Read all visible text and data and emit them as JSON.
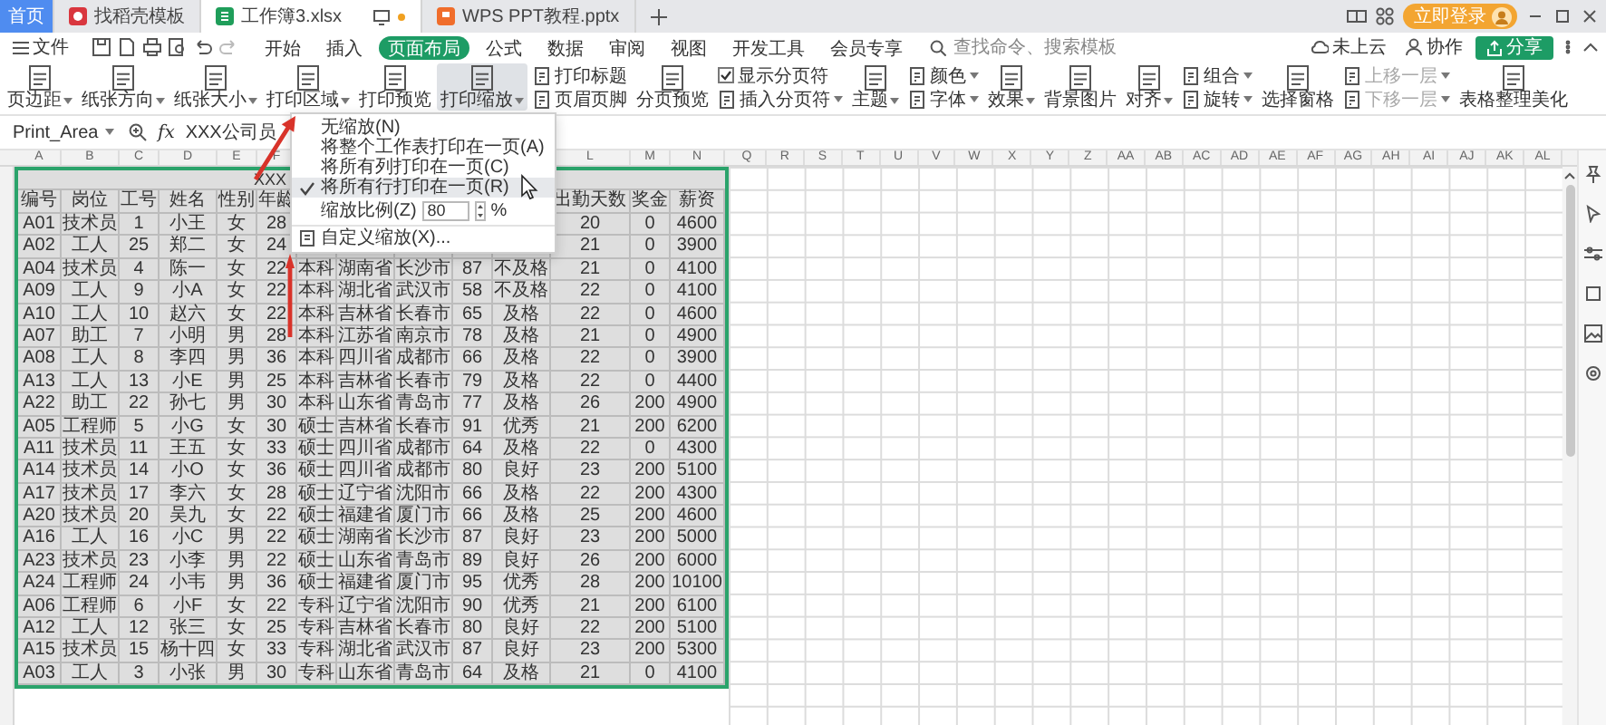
{
  "tabs": [
    {
      "label": "首页",
      "kind": "home",
      "selected": false,
      "modified": false
    },
    {
      "label": "找稻壳模板",
      "kind": "template",
      "selected": false,
      "modified": false
    },
    {
      "label": "工作簿3.xlsx",
      "kind": "sheet",
      "selected": true,
      "modified": true
    },
    {
      "label": "WPS PPT教程.pptx",
      "kind": "slides",
      "selected": false,
      "modified": false
    }
  ],
  "account": {
    "label": "立即登录"
  },
  "menu": {
    "file": "文件",
    "tabs": [
      {
        "label": "开始",
        "selected": false
      },
      {
        "label": "插入",
        "selected": false
      },
      {
        "label": "页面布局",
        "selected": true
      },
      {
        "label": "公式",
        "selected": false
      },
      {
        "label": "数据",
        "selected": false
      },
      {
        "label": "审阅",
        "selected": false
      },
      {
        "label": "视图",
        "selected": false
      },
      {
        "label": "开发工具",
        "selected": false
      },
      {
        "label": "会员专享",
        "selected": false
      }
    ],
    "search": {
      "placeholder": "查找命令、搜索模板"
    },
    "cloud": "未上云",
    "collab": "协作",
    "share": "分享"
  },
  "ribbon": [
    {
      "kind": "large",
      "label": "页边距",
      "caret": true,
      "selected": false
    },
    {
      "kind": "large",
      "label": "纸张方向",
      "caret": true,
      "selected": false
    },
    {
      "kind": "large",
      "label": "纸张大小",
      "caret": true,
      "selected": false
    },
    {
      "kind": "large",
      "label": "打印区域",
      "caret": true,
      "selected": false
    },
    {
      "kind": "large",
      "label": "打印预览",
      "caret": false,
      "selected": false
    },
    {
      "kind": "large",
      "label": "打印缩放",
      "caret": true,
      "selected": true
    },
    {
      "kind": "stack",
      "items": [
        {
          "kind": "button",
          "label": "打印标题",
          "caret": false,
          "disabled": false
        },
        {
          "kind": "button",
          "label": "页眉页脚",
          "caret": false,
          "disabled": false
        }
      ]
    },
    {
      "kind": "large",
      "label": "分页预览",
      "caret": false,
      "selected": false
    },
    {
      "kind": "stack",
      "items": [
        {
          "kind": "checkbox",
          "label": "显示分页符",
          "checked": true,
          "caret": false,
          "disabled": false
        },
        {
          "kind": "button",
          "label": "插入分页符",
          "caret": true,
          "disabled": false
        }
      ]
    },
    {
      "kind": "large",
      "label": "主题",
      "caret": true,
      "selected": false
    },
    {
      "kind": "stack",
      "items": [
        {
          "kind": "button",
          "label": "颜色",
          "caret": true,
          "disabled": false
        },
        {
          "kind": "button",
          "label": "字体",
          "caret": true,
          "disabled": false
        }
      ]
    },
    {
      "kind": "large",
      "label": "效果",
      "caret": true,
      "selected": false
    },
    {
      "kind": "large",
      "label": "背景图片",
      "caret": false,
      "selected": false
    },
    {
      "kind": "large",
      "label": "对齐",
      "caret": true,
      "selected": false
    },
    {
      "kind": "stack",
      "items": [
        {
          "kind": "button",
          "label": "组合",
          "caret": true,
          "disabled": false
        },
        {
          "kind": "button",
          "label": "旋转",
          "caret": true,
          "disabled": false
        }
      ]
    },
    {
      "kind": "large",
      "label": "选择窗格",
      "caret": false,
      "selected": false
    },
    {
      "kind": "stack",
      "items": [
        {
          "kind": "button",
          "label": "上移一层",
          "caret": true,
          "disabled": true
        },
        {
          "kind": "button",
          "label": "下移一层",
          "caret": true,
          "disabled": true
        }
      ]
    },
    {
      "kind": "large",
      "label": "表格整理美化",
      "caret": false,
      "selected": false
    }
  ],
  "formula_bar": {
    "name_box": "Print_Area",
    "function": "fx",
    "value": "XXX公司员"
  },
  "sheet": {
    "columns_left": {
      "before_menu": [
        "A",
        "B",
        "C",
        "D",
        "E",
        "F"
      ],
      "after_menu": [
        "L",
        "M",
        "N"
      ]
    },
    "columns_right": [
      "Q",
      "R",
      "S",
      "T",
      "U",
      "V",
      "W",
      "X",
      "Y",
      "Z",
      "AA",
      "AB",
      "AC",
      "AD",
      "AE",
      "AF",
      "AG",
      "AH",
      "AI",
      "AJ",
      "AK",
      "AL"
    ],
    "title": "XXX",
    "header": {
      "before_menu": [
        "编号",
        "岗位",
        "工号",
        "姓名",
        "性别",
        "年龄"
      ],
      "after_menu": [
        "出勤天数",
        "奖金",
        "薪资"
      ]
    },
    "rows": [
      [
        "A01",
        "技术员",
        "1",
        "小王",
        "女",
        "28",
        null,
        null,
        null,
        null,
        null,
        "20",
        "0",
        "4600"
      ],
      [
        "A02",
        "工人",
        "25",
        "郑二",
        "女",
        "24",
        null,
        null,
        null,
        null,
        null,
        "21",
        "0",
        "3900"
      ],
      [
        "A04",
        "技术员",
        "4",
        "陈一",
        "女",
        "22",
        "本科",
        "湖南省",
        "长沙市",
        "87",
        "不及格",
        "21",
        "0",
        "4100"
      ],
      [
        "A09",
        "工人",
        "9",
        "小A",
        "女",
        "22",
        "本科",
        "湖北省",
        "武汉市",
        "58",
        "不及格",
        "22",
        "0",
        "4100"
      ],
      [
        "A10",
        "工人",
        "10",
        "赵六",
        "女",
        "22",
        "本科",
        "吉林省",
        "长春市",
        "65",
        "及格",
        "22",
        "0",
        "4600"
      ],
      [
        "A07",
        "助工",
        "7",
        "小明",
        "男",
        "28",
        "本科",
        "江苏省",
        "南京市",
        "78",
        "及格",
        "21",
        "0",
        "4900"
      ],
      [
        "A08",
        "工人",
        "8",
        "李四",
        "男",
        "36",
        "本科",
        "四川省",
        "成都市",
        "66",
        "及格",
        "22",
        "0",
        "3900"
      ],
      [
        "A13",
        "工人",
        "13",
        "小E",
        "男",
        "25",
        "本科",
        "吉林省",
        "长春市",
        "79",
        "及格",
        "22",
        "0",
        "4400"
      ],
      [
        "A22",
        "助工",
        "22",
        "孙七",
        "男",
        "30",
        "本科",
        "山东省",
        "青岛市",
        "77",
        "及格",
        "26",
        "200",
        "4900"
      ],
      [
        "A05",
        "工程师",
        "5",
        "小G",
        "女",
        "30",
        "硕士",
        "吉林省",
        "长春市",
        "91",
        "优秀",
        "21",
        "200",
        "6200"
      ],
      [
        "A11",
        "技术员",
        "11",
        "王五",
        "女",
        "33",
        "硕士",
        "四川省",
        "成都市",
        "64",
        "及格",
        "22",
        "0",
        "4300"
      ],
      [
        "A14",
        "技术员",
        "14",
        "小O",
        "女",
        "36",
        "硕士",
        "四川省",
        "成都市",
        "80",
        "良好",
        "23",
        "200",
        "5100"
      ],
      [
        "A17",
        "技术员",
        "17",
        "李六",
        "女",
        "28",
        "硕士",
        "辽宁省",
        "沈阳市",
        "66",
        "及格",
        "22",
        "200",
        "4300"
      ],
      [
        "A20",
        "技术员",
        "20",
        "吴九",
        "女",
        "22",
        "硕士",
        "福建省",
        "厦门市",
        "66",
        "及格",
        "25",
        "200",
        "4600"
      ],
      [
        "A16",
        "工人",
        "16",
        "小C",
        "男",
        "22",
        "硕士",
        "湖南省",
        "长沙市",
        "87",
        "良好",
        "23",
        "200",
        "5000"
      ],
      [
        "A23",
        "技术员",
        "23",
        "小李",
        "男",
        "22",
        "硕士",
        "山东省",
        "青岛市",
        "89",
        "良好",
        "26",
        "200",
        "6000"
      ],
      [
        "A24",
        "工程师",
        "24",
        "小韦",
        "男",
        "36",
        "硕士",
        "福建省",
        "厦门市",
        "95",
        "优秀",
        "28",
        "200",
        "10100"
      ],
      [
        "A06",
        "工程师",
        "6",
        "小F",
        "女",
        "22",
        "专科",
        "辽宁省",
        "沈阳市",
        "90",
        "优秀",
        "21",
        "200",
        "6100"
      ],
      [
        "A12",
        "工人",
        "12",
        "张三",
        "女",
        "25",
        "专科",
        "吉林省",
        "长春市",
        "80",
        "良好",
        "22",
        "200",
        "5100"
      ],
      [
        "A15",
        "技术员",
        "15",
        "杨十四",
        "女",
        "33",
        "专科",
        "湖北省",
        "武汉市",
        "87",
        "良好",
        "23",
        "200",
        "5300"
      ],
      [
        "A03",
        "工人",
        "3",
        "小张",
        "男",
        "30",
        "专科",
        "山东省",
        "青岛市",
        "64",
        "及格",
        "21",
        "0",
        "4100"
      ]
    ]
  },
  "dropdown": {
    "items": [
      {
        "kind": "option",
        "label": "无缩放(N)",
        "checked": false
      },
      {
        "kind": "option",
        "label": "将整个工作表打印在一页(A)",
        "checked": false
      },
      {
        "kind": "option",
        "label": "将所有列打印在一页(C)",
        "checked": false
      },
      {
        "kind": "option",
        "label": "将所有行打印在一页(R)",
        "checked": true
      },
      {
        "kind": "zoom",
        "label": "缩放比例(Z)",
        "value": "80",
        "unit": "%"
      },
      {
        "kind": "custom",
        "label": "自定义缩放(X)..."
      }
    ]
  }
}
